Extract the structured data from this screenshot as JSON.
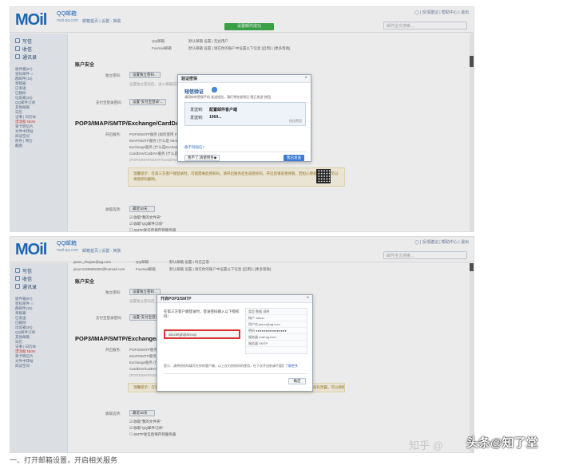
{
  "app": {
    "logo": "MOil",
    "logo_qq": "QQ邮箱",
    "logo_sub": "mail.qq.com",
    "toplinks": "邮箱首页 | 设置 - 换肤",
    "top_right": "◯ | 反馈建议 | 帮助中心 | 退出",
    "search_placeholder": "邮件全文搜索...",
    "green_badge": "设置邮件成功"
  },
  "sidebar": {
    "write": "写信",
    "receive": "收信",
    "contacts": "通讯录",
    "items": [
      "收件箱(87)",
      "星标邮件 ☆",
      "群邮件(15)",
      "草稿箱",
      "已发送",
      "已删除",
      "垃圾箱(46)",
      "QQ邮件订阅",
      "",
      "其他邮箱",
      "日历",
      "",
      "记事 | 日历本",
      "漂流瓶 NEW",
      "贺卡明信片",
      "文件中转站",
      "阅读空间",
      "附件 | 简历",
      "截图"
    ],
    "hot_index": 13
  },
  "screen1": {
    "acct_row1_addr": "QQ邮箱",
    "acct_row1_status": "默认邮箱  设置 | 无此用户",
    "acct_row2_addr": "Foxmail邮箱",
    "acct_row2_status": "默认邮箱  设置 | 请在你的账户中设置以下信息 [启用] | [更多帮助]",
    "section_security": "账户安全",
    "independent_pw_label": "独立密码:",
    "independent_pw_btn": "设置独立密码...",
    "independent_pw_note": "设置独立密码后，进入邮箱前需验证...",
    "admin_pw_label": "支付宝登录密码:",
    "admin_pw_btn": "设置\"支付宝登录\"...",
    "section_pop": "POP3/IMAP/SMTP/Exchange/CardDAV/",
    "service_label": "开启服务:",
    "services": [
      "POP3/SMTP服务 (如何使用 Fox...",
      "IMAP/SMTP服务 (什么是 IMAP，...",
      "Exchange服务 (什么是Exchan...",
      "CardDAV/CalDAV服务 (什么是...",
      "(POP3/IMAP/SMTP/CardDAV..."
    ],
    "note_text": "温馨提示：在第三方客户端登录时，可能需要此授权码。请开启服务后生成授权码，开启后请妥善保管，若担心授权码泄露，可以将授权码删除。",
    "receive_label": "收取选项:",
    "receive_select": "最近30天",
    "receive_checks": [
      "收取\"我的文件夹\"",
      "收取\"QQ邮件订阅\"",
      "SMTP发信后保存到服务器"
    ],
    "dialog": {
      "title": "验证密保",
      "heading": "短信验证",
      "desc": "请用你的密保手机 发送短信，我们将在收到后\"我已发送\"按钮",
      "send_to_label": "发送到:",
      "send_to_value": "配置邮件客户端",
      "number_label": "发送到:",
      "number_value": "1069...",
      "hint": "短信费用",
      "link": "收不到短信?",
      "select_label": "我不了,请使用另◆",
      "sent_btn": "我已发送"
    }
  },
  "screen2": {
    "acct_row1_addr": "jason_zhujian@qq.com",
    "acct_row1_type": "QQ邮箱",
    "acct_row1_status": "默认邮箱  设置 | 均已正常",
    "acct_row2_addr": "jason1158986393@hotmail.com",
    "acct_row2_type": "Foxmail邮箱",
    "acct_row2_status": "默认邮箱  设置 | 请在你的账户中设置以下信息 [启用] | [更多帮助]",
    "section_security": "账户安全",
    "section_pop": "POP3/IMAP/SMTP/Exchange/CardD",
    "dialog": {
      "title": "开启POP3/SMTP",
      "desc": "在第三方客户端登录时，登录密码输入以下授权码：",
      "code": "abcdefghijklmnop",
      "table_rows": [
        "类型    数据    说明",
        "帐户    Jason",
        "用户名   jason@qq.com",
        "密码    ●●●●●●●●●●●●●●●●",
        "服务器   mail.qq.com",
        "服务器   SMTP"
      ],
      "footer": "提示：请将授权码填写在你的客户端，以上仅为授权码的使用，在下次开启前请不要删除。",
      "footer_link": "了解更多",
      "ok_btn": "确定"
    },
    "receive_label": "收取选项:",
    "receive_select": "最近30天"
  },
  "watermark": {
    "zhihu": "知乎 @",
    "handle": "头条@知了堂"
  },
  "caption": "一、打开邮箱设置，开启相关服务"
}
